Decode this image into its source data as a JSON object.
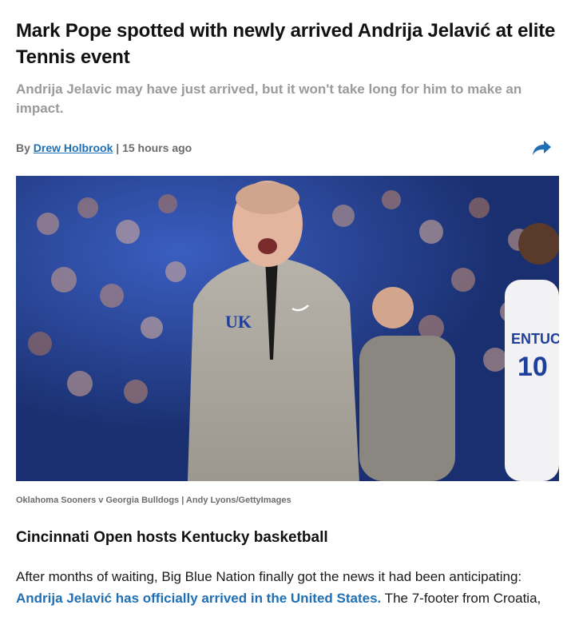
{
  "article": {
    "headline": "Mark Pope spotted with newly arrived Andrija Jelavić at elite Tennis event",
    "subheadline": "Andrija Jelavic may have just arrived, but it won't take long for him to make an impact.",
    "byline_prefix": "By",
    "author": "Drew Holbrook",
    "separator": "|",
    "timestamp": "15 hours ago",
    "share_icon": "share-arrow-icon"
  },
  "hero_image": {
    "caption": "Oklahoma Sooners v Georgia Bulldogs | Andy Lyons/GettyImages",
    "jacket_logo": "UK",
    "jersey_text": "ENTUCKY",
    "jersey_number": "10"
  },
  "section": {
    "title": "Cincinnati Open hosts Kentucky basketball"
  },
  "paragraph": {
    "line1": "After months of waiting, Big Blue Nation finally got the news it had been anticipating:",
    "link_text": "Andrija Jelavić has officially arrived in the United States.",
    "line2_rest": " The 7-footer from Croatia,"
  },
  "colors": {
    "link": "#1f6fb5",
    "subhead": "#9a9a9a",
    "caption": "#6d6d6d"
  }
}
